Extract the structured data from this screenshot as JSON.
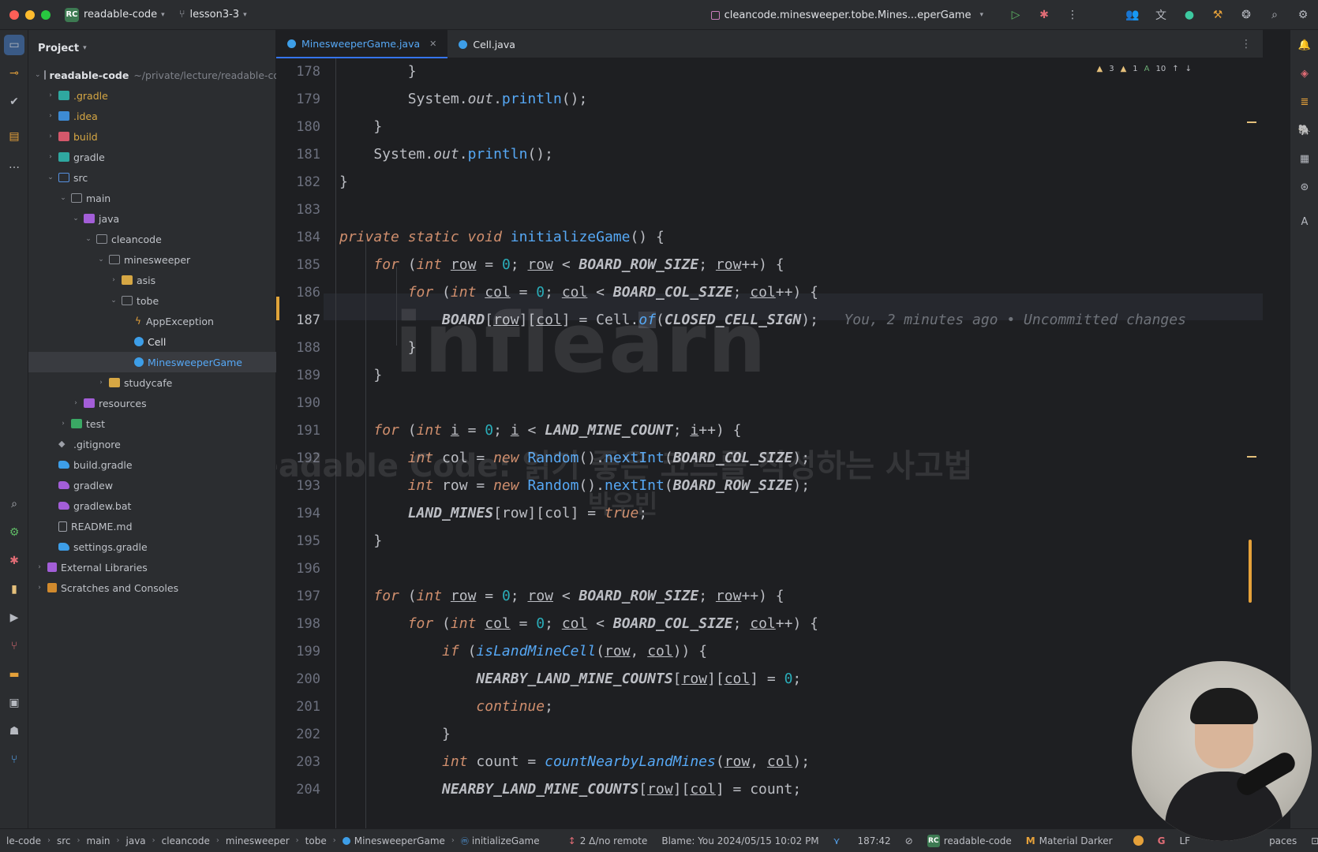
{
  "titlebar": {
    "project_badge": "RC",
    "project_name": "readable-code",
    "branch": "lesson3-3",
    "run_config": "cleancode.minesweeper.tobe.Mines...eperGame"
  },
  "project_panel": {
    "title": "Project",
    "root_name": "readable-code",
    "root_path": "~/private/lecture/readable-co",
    "items": [
      {
        "label": ".gradle"
      },
      {
        "label": ".idea"
      },
      {
        "label": "build"
      },
      {
        "label": "gradle"
      },
      {
        "label": "src"
      },
      {
        "label": "main"
      },
      {
        "label": "java"
      },
      {
        "label": "cleancode"
      },
      {
        "label": "minesweeper"
      },
      {
        "label": "asis"
      },
      {
        "label": "tobe"
      },
      {
        "label": "AppException"
      },
      {
        "label": "Cell"
      },
      {
        "label": "MinesweeperGame"
      },
      {
        "label": "studycafe"
      },
      {
        "label": "resources"
      },
      {
        "label": "test"
      },
      {
        "label": ".gitignore"
      },
      {
        "label": "build.gradle"
      },
      {
        "label": "gradlew"
      },
      {
        "label": "gradlew.bat"
      },
      {
        "label": "README.md"
      },
      {
        "label": "settings.gradle"
      },
      {
        "label": "External Libraries"
      },
      {
        "label": "Scratches and Consoles"
      }
    ]
  },
  "tabs": [
    {
      "label": "MinesweeperGame.java"
    },
    {
      "label": "Cell.java"
    }
  ],
  "inspections": {
    "warnings": "3",
    "weak_warnings": "1",
    "typos": "10"
  },
  "gutter": [
    "178",
    "179",
    "180",
    "181",
    "182",
    "183",
    "184",
    "185",
    "186",
    "187",
    "188",
    "189",
    "190",
    "191",
    "192",
    "193",
    "194",
    "195",
    "196",
    "197",
    "198",
    "199",
    "200",
    "201",
    "202",
    "203",
    "204"
  ],
  "blame_inline": "You, 2 minutes ago • Uncommitted changes",
  "watermark": {
    "logo": "inflearn",
    "subtitle": "Readable Code: 읽기 좋은 코드를 작성하는 사고법",
    "author": "박우빈"
  },
  "statusbar": {
    "breadcrumbs": [
      "le-code",
      "src",
      "main",
      "java",
      "cleancode",
      "minesweeper",
      "tobe",
      "MinesweeperGame",
      "initializeGame"
    ],
    "vcs": "2 Δ/no remote",
    "blame": "Blame: You 2024/05/15 10:02 PM",
    "position": "187:42",
    "project": "readable-code",
    "theme": "Material Darker",
    "line_sep": "LF",
    "indent": "paces"
  }
}
